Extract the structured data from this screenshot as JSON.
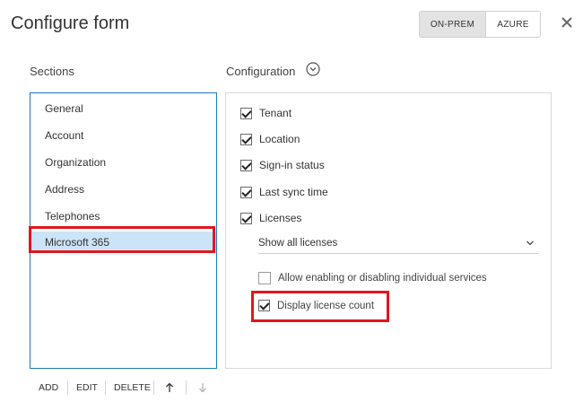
{
  "dialog": {
    "title": "Configure form"
  },
  "mode_toggle": {
    "options": [
      "ON-PREM",
      "AZURE"
    ],
    "selected": "ON-PREM"
  },
  "sections": {
    "label": "Sections",
    "items": [
      "General",
      "Account",
      "Organization",
      "Address",
      "Telephones",
      "Microsoft 365"
    ],
    "selected": "Microsoft 365"
  },
  "configuration": {
    "label": "Configuration",
    "fields": [
      {
        "label": "Tenant",
        "checked": true
      },
      {
        "label": "Location",
        "checked": true
      },
      {
        "label": "Sign-in status",
        "checked": true
      },
      {
        "label": "Last sync time",
        "checked": true
      },
      {
        "label": "Licenses",
        "checked": true
      }
    ],
    "licenses_dropdown": {
      "value": "Show all licenses"
    },
    "sub_options": [
      {
        "label": "Allow enabling or disabling individual services",
        "checked": false
      },
      {
        "label": "Display license count",
        "checked": true
      }
    ]
  },
  "footer": {
    "add": "ADD",
    "edit": "EDIT",
    "delete": "DELETE"
  },
  "colors": {
    "accent_blue": "#1c7ab8",
    "selection": "#cce4f7",
    "highlight_red": "#e2161e"
  },
  "icons": {
    "close": "close-icon",
    "chevron": "chevron-down-circle-icon",
    "up": "arrow-up-icon",
    "down": "arrow-down-icon"
  }
}
